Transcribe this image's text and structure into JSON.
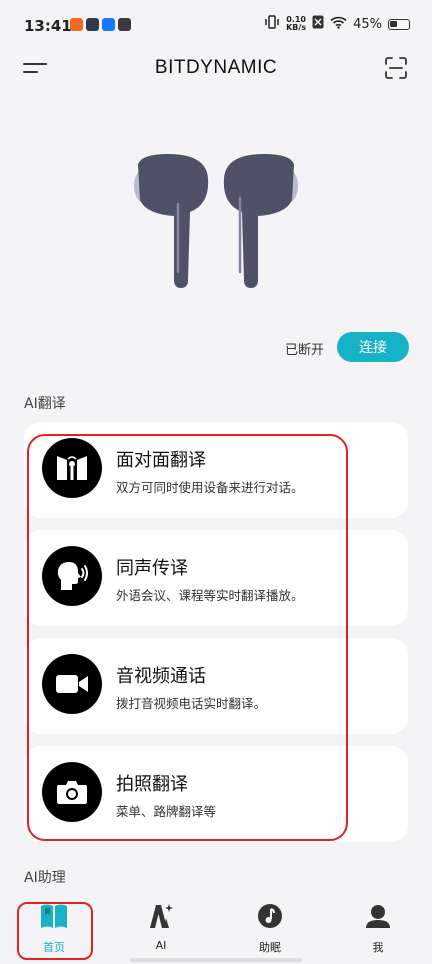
{
  "status_bar": {
    "time": "13:41",
    "net_speed_value": "0.10",
    "net_speed_unit": "KB/s",
    "battery_percent": "45%"
  },
  "header": {
    "title": "BITDYNAMIC"
  },
  "device": {
    "connection_status": "已断开",
    "connect_label": "连接"
  },
  "sections": {
    "ai_translate": "AI翻译",
    "ai_assistant": "AI助理"
  },
  "cards": [
    {
      "title": "面对面翻译",
      "desc": "双方可同时使用设备来进行对话。",
      "icon": "face-to-face-icon"
    },
    {
      "title": "同声传译",
      "desc": "外语会议、课程等实时翻译播放。",
      "icon": "speaking-head-icon"
    },
    {
      "title": "音视频通话",
      "desc": "拨打音视频电话实时翻译。",
      "icon": "video-camera-icon"
    },
    {
      "title": "拍照翻译",
      "desc": "菜单、路牌翻译等",
      "icon": "camera-icon"
    }
  ],
  "nav": [
    {
      "label": "首页",
      "icon": "book-icon"
    },
    {
      "label": "AI",
      "icon": "ai-sparkle-icon"
    },
    {
      "label": "助眠",
      "icon": "music-note-icon"
    },
    {
      "label": "我",
      "icon": "person-icon"
    }
  ],
  "colors": {
    "accent": "#16b3c6",
    "earbud": "#4f5169",
    "highlight": "#e32222",
    "background": "#f4f4f6"
  }
}
